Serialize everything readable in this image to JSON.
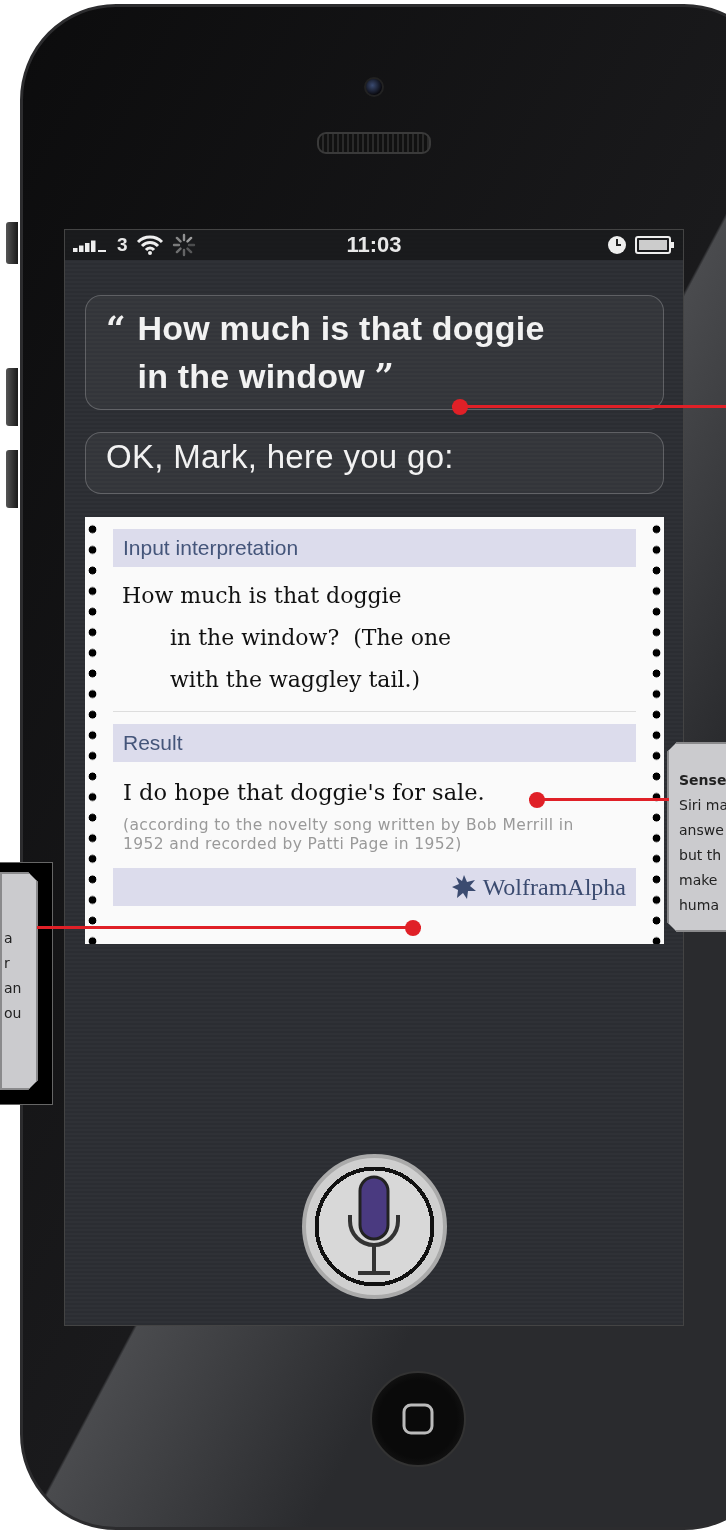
{
  "status_bar": {
    "carrier": "3",
    "time": "11:03"
  },
  "user_bubble": {
    "open_quote": "“",
    "text": "How much is that doggie in the window",
    "close_quote": "”"
  },
  "siri_reply": "OK, Mark, here you go:",
  "result_card": {
    "sections": [
      {
        "kind": "heading",
        "text": "Input interpretation"
      },
      {
        "kind": "query",
        "text": "How much is that doggie\nin the window?  (The one\nwith the waggley tail.)"
      },
      {
        "kind": "heading",
        "text": "Result"
      },
      {
        "kind": "answer",
        "text": "I do hope that doggie's for sale."
      },
      {
        "kind": "note",
        "text": "(according to the novelty song written by Bob Merrill in 1952 and recorded by Patti Page in 1952)"
      },
      {
        "kind": "footer",
        "text": "WolframAlpha"
      }
    ]
  },
  "callouts": [
    {
      "kind": "left",
      "lines": [
        "a",
        "r",
        "an",
        "ou"
      ]
    },
    {
      "kind": "right",
      "title": "Sense",
      "lines": [
        "Siri ma",
        "answe",
        "but th",
        "make",
        "huma"
      ]
    }
  ]
}
